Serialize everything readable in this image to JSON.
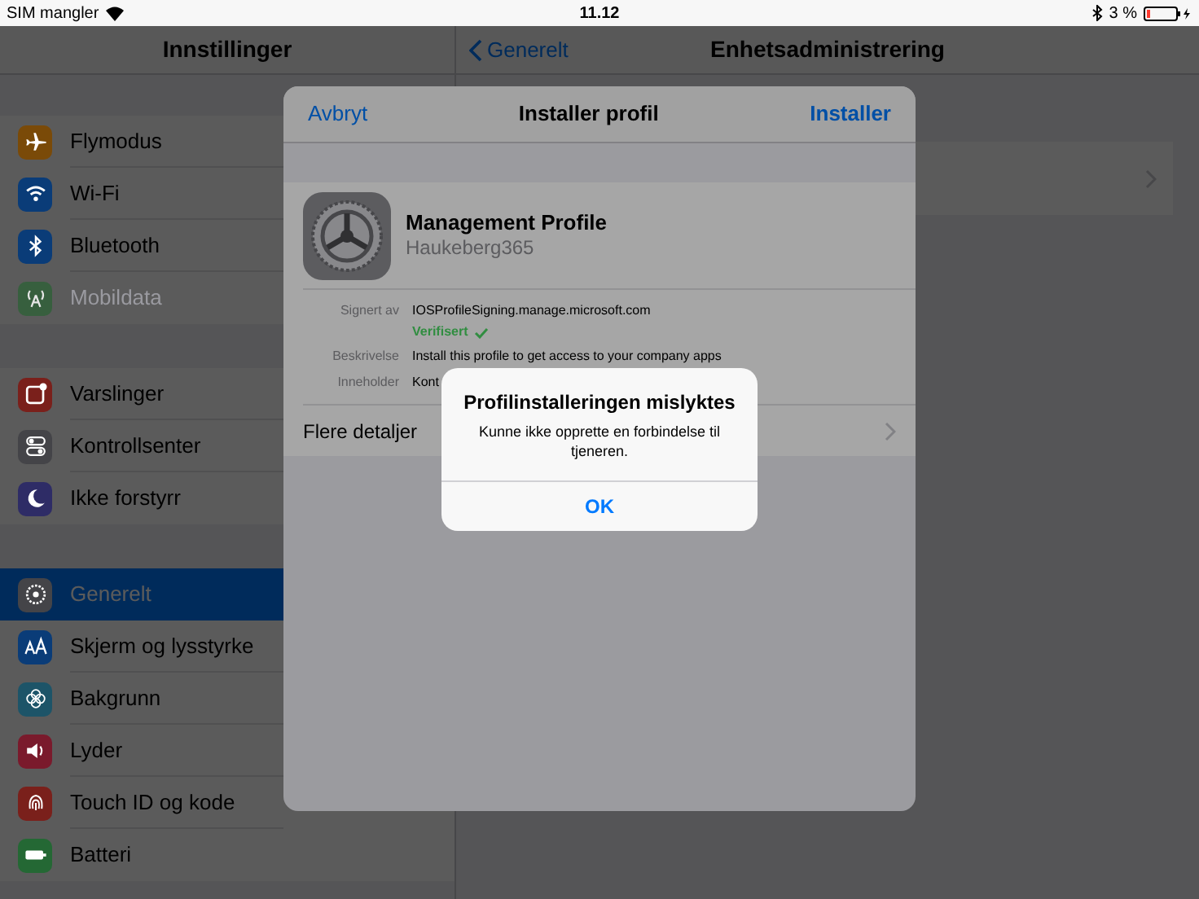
{
  "status_bar": {
    "carrier": "SIM mangler",
    "time": "11.12",
    "battery": "3 %"
  },
  "sidebar": {
    "title": "Innstillinger",
    "groups": [
      [
        {
          "label": "Flymodus",
          "color": "#7a4a08",
          "selected": false,
          "disabled": false
        },
        {
          "label": "Wi-Fi",
          "color": "#0a3c78",
          "selected": false,
          "disabled": false
        },
        {
          "label": "Bluetooth",
          "color": "#0a3c78",
          "selected": false,
          "disabled": false
        },
        {
          "label": "Mobildata",
          "color": "#3d6a45",
          "selected": false,
          "disabled": true
        }
      ],
      [
        {
          "label": "Varslinger",
          "color": "#7a201b",
          "selected": false,
          "disabled": false
        },
        {
          "label": "Kontrollsenter",
          "color": "#444448",
          "selected": false,
          "disabled": false
        },
        {
          "label": "Ikke forstyrr",
          "color": "#2e2c66",
          "selected": false,
          "disabled": false
        }
      ],
      [
        {
          "label": "Generelt",
          "color": "#444448",
          "selected": true,
          "disabled": false
        },
        {
          "label": "Skjerm og lysstyrke",
          "color": "#0a3c78",
          "selected": false,
          "disabled": false
        },
        {
          "label": "Bakgrunn",
          "color": "#1d5468",
          "selected": false,
          "disabled": false
        },
        {
          "label": "Lyder",
          "color": "#7a1a2c",
          "selected": false,
          "disabled": false
        },
        {
          "label": "Touch ID og kode",
          "color": "#7a201b",
          "selected": false,
          "disabled": false
        },
        {
          "label": "Batteri",
          "color": "#246834",
          "selected": false,
          "disabled": false
        }
      ]
    ]
  },
  "detail": {
    "back": "Generelt",
    "title": "Enhetsadministrering"
  },
  "modal": {
    "cancel": "Avbryt",
    "title": "Installer profil",
    "install": "Installer",
    "profile_name": "Management Profile",
    "organization": "Haukeberg365",
    "details": [
      {
        "label": "Signert av",
        "value": "IOSProfileSigning.manage.microsoft.com",
        "status": "Verifisert"
      },
      {
        "label": "Beskrivelse",
        "value": "Install this profile to get access to your company apps"
      },
      {
        "label": "Inneholder",
        "value": "Kont"
      }
    ],
    "more": "Flere detaljer"
  },
  "alert": {
    "title": "Profilinstalleringen mislyktes",
    "message": "Kunne ikke opprette en forbindelse til tjeneren.",
    "button": "OK"
  }
}
